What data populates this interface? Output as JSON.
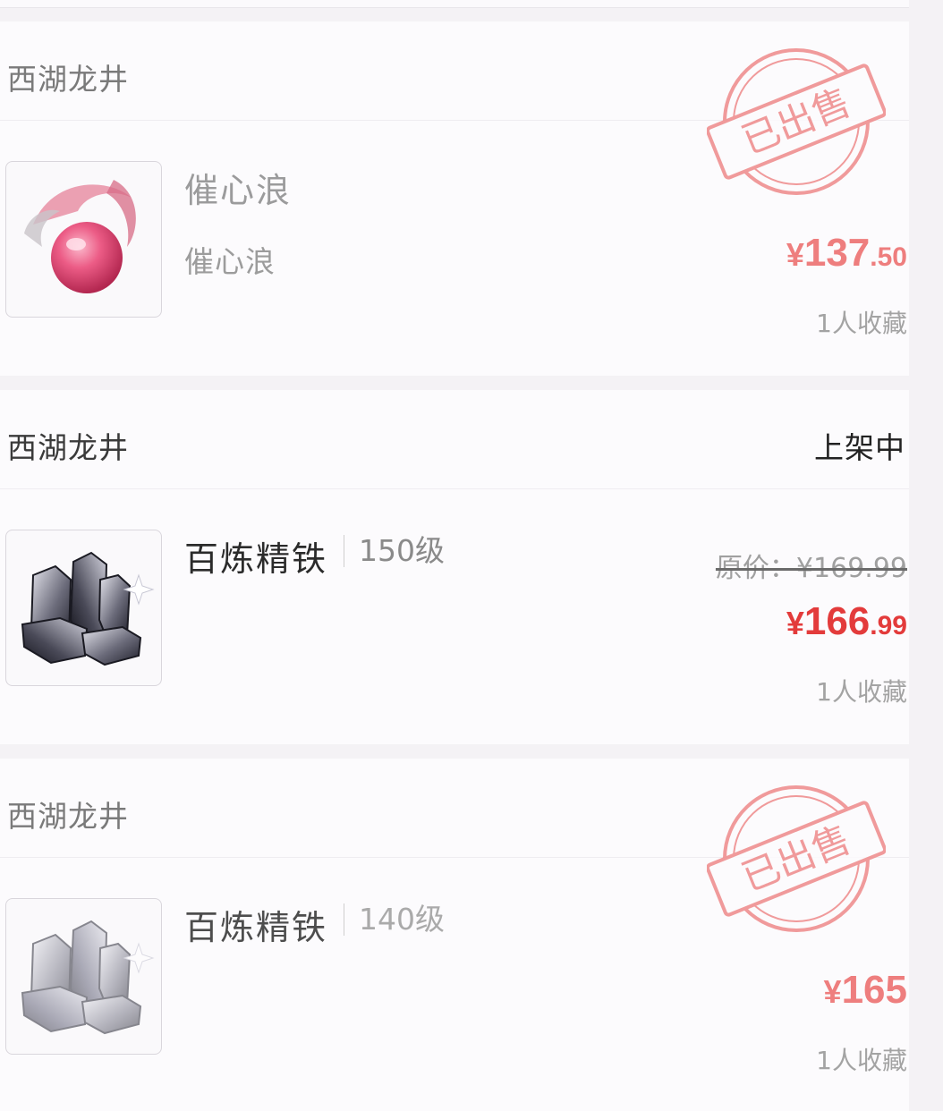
{
  "listings": [
    {
      "seller": "西湖龙井",
      "status": "已出售",
      "item_name": "催心浪",
      "item_subtitle": "催心浪",
      "item_level": "",
      "original_price": "",
      "price_currency": "¥",
      "price_integer": "137",
      "price_decimal": ".50",
      "favorites": "1人收藏",
      "icon": "pink-orb-icon"
    },
    {
      "seller": "西湖龙井",
      "status": "上架中",
      "item_name": "百炼精铁",
      "item_subtitle": "",
      "item_level": "150级",
      "original_price": "原价：¥169.99",
      "price_currency": "¥",
      "price_integer": "166",
      "price_decimal": ".99",
      "favorites": "1人收藏",
      "icon": "iron-crystal-icon"
    },
    {
      "seller": "西湖龙井",
      "status": "已出售",
      "item_name": "百炼精铁",
      "item_subtitle": "",
      "item_level": "140级",
      "original_price": "",
      "price_currency": "¥",
      "price_integer": "165",
      "price_decimal": "",
      "favorites": "1人收藏",
      "icon": "iron-crystal-icon"
    }
  ],
  "colors": {
    "price": "#e33b3b",
    "price_sold": "#ee7e7e",
    "stamp": "#ee8a8a",
    "background": "#f4f2f5"
  }
}
